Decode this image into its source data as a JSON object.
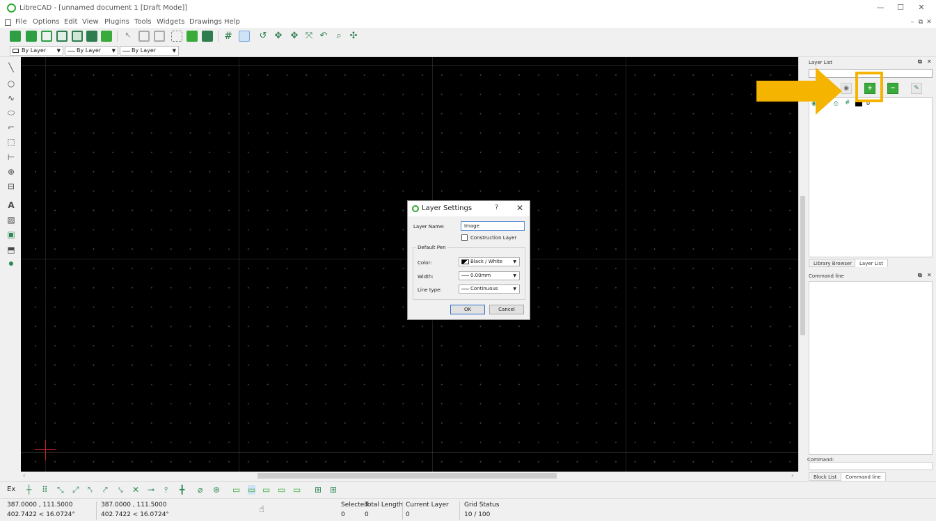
{
  "window": {
    "title": "LibreCAD - [unnamed document 1 [Draft Mode]]",
    "controls": {
      "minimize": "—",
      "maximize": "☐",
      "close": "✕"
    }
  },
  "menu": {
    "items": [
      "File",
      "Options",
      "Edit",
      "View",
      "Plugins",
      "Tools",
      "Widgets",
      "Drawings",
      "Help"
    ],
    "mdi_controls": [
      "–",
      "⧉",
      "✕"
    ]
  },
  "pen_toolbar": {
    "color": "By Layer",
    "width": "By Layer",
    "line_type": "By Layer"
  },
  "dialog": {
    "title": "Layer Settings",
    "help": "?",
    "close": "✕",
    "layer_name_label": "Layer Name:",
    "layer_name_value": "Image",
    "construction_label": "Construction Layer",
    "group_label": "Default Pen",
    "color_label": "Color:",
    "color_value": "Black / White",
    "width_label": "Width:",
    "width_value": "0.00mm",
    "linetype_label": "Line type:",
    "linetype_value": "Continuous",
    "ok": "OK",
    "cancel": "Cancel"
  },
  "layer_panel": {
    "title": "Layer List",
    "layer_name": "0",
    "tabs": [
      "Library Browser",
      "Layer List"
    ]
  },
  "command_panel": {
    "title": "Command line",
    "prompt": "Command:",
    "tabs": [
      "Block List",
      "Command line"
    ]
  },
  "snap_toolbar": {
    "label": "Ex"
  },
  "status": {
    "coord_abs_1": "387.0000 , 111.5000",
    "coord_abs_2": "402.7422 < 16.0724°",
    "coord_rel_1": "387.0000 , 111.5000",
    "coord_rel_2": "402.7422 < 16.0724°",
    "selected_label": "Selected",
    "selected_value": "0",
    "total_length_label": "Total Length",
    "total_length_value": "0",
    "current_layer_label": "Current Layer",
    "current_layer_value": "0",
    "grid_status_label": "Grid Status",
    "grid_status_value": "10 / 100"
  },
  "colors": {
    "accent_green": "#3aaa3a",
    "highlight_yellow": "#f5b400",
    "canvas_bg": "#000000"
  }
}
